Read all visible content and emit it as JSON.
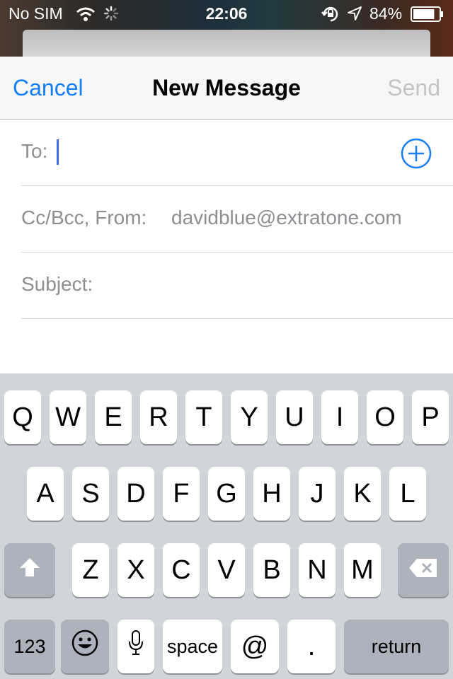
{
  "status_bar": {
    "carrier": "No SIM",
    "time": "22:06",
    "battery_percent": "84%",
    "battery_level": 0.84,
    "icons": [
      "wifi-icon",
      "activity-spinner-icon",
      "orientation-lock-icon",
      "location-arrow-icon",
      "battery-icon"
    ]
  },
  "nav": {
    "cancel": "Cancel",
    "title": "New Message",
    "send": "Send"
  },
  "fields": {
    "to_label": "To:",
    "ccbcc_label": "Cc/Bcc, From:",
    "from_value": "davidblue@extratone.com",
    "subject_label": "Subject:"
  },
  "keyboard": {
    "row1": [
      "Q",
      "W",
      "E",
      "R",
      "T",
      "Y",
      "U",
      "I",
      "O",
      "P"
    ],
    "row2": [
      "A",
      "S",
      "D",
      "F",
      "G",
      "H",
      "J",
      "K",
      "L"
    ],
    "row3": [
      "Z",
      "X",
      "C",
      "V",
      "B",
      "N",
      "M"
    ],
    "numbers": "123",
    "space": "space",
    "at": "@",
    "period": ".",
    "return": "return"
  },
  "colors": {
    "accent": "#157efb",
    "send_disabled": "#c4c4c4",
    "cursor": "#3b6be6"
  }
}
